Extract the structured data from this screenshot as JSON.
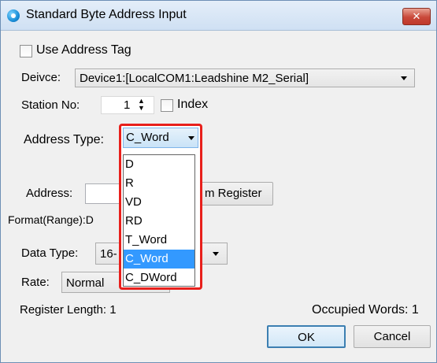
{
  "window": {
    "title": "Standard Byte Address Input",
    "close_label": "x"
  },
  "use_tag": {
    "label": "Use Address Tag",
    "checked": false
  },
  "device": {
    "label": "Deivce:",
    "value": "Device1:[LocalCOM1:Leadshine M2_Serial]"
  },
  "station": {
    "label": "Station No:",
    "value": "1",
    "index_label": "Index",
    "index_checked": false
  },
  "address_type": {
    "label": "Address Type:",
    "value": "C_Word",
    "options": [
      "D",
      "R",
      "VD",
      "RD",
      "T_Word",
      "C_Word",
      "C_DWord"
    ],
    "selected_index": 5
  },
  "address": {
    "label": "Address:",
    "value": "",
    "system_register_button": "m Register"
  },
  "format": {
    "label": "Format(Range):D"
  },
  "data_type": {
    "label": "Data Type:",
    "value": "16-"
  },
  "rate": {
    "label": "Rate:",
    "value": "Normal"
  },
  "footer": {
    "register_length": "Register Length: 1",
    "occupied_words": "Occupied Words: 1",
    "ok_label": "OK",
    "cancel_label": "Cancel"
  }
}
